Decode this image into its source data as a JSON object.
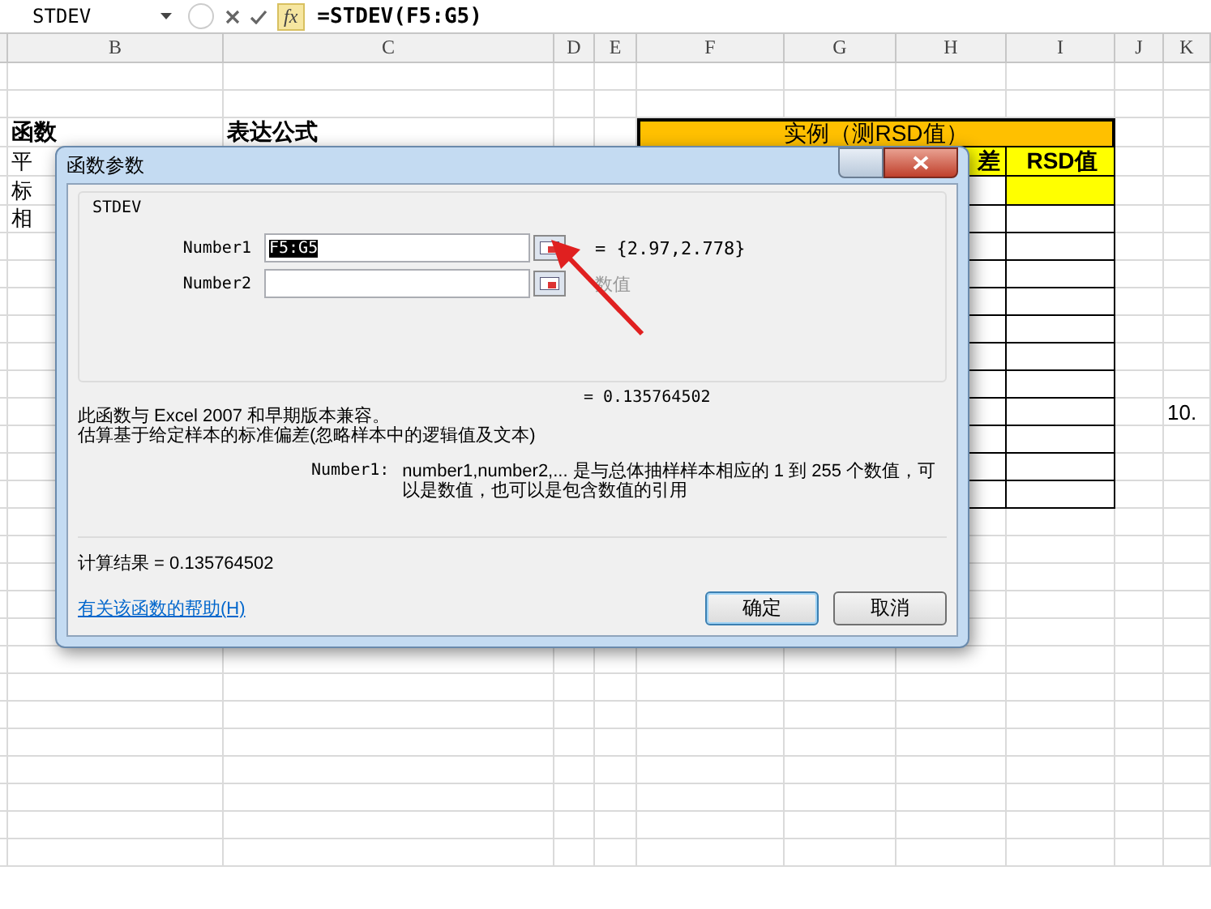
{
  "formula_bar": {
    "name_box": "STDEV",
    "fx": "fx",
    "formula": "=STDEV(F5:G5)"
  },
  "sheet": {
    "columns": [
      "B",
      "C",
      "D",
      "E",
      "F",
      "G",
      "H",
      "I",
      "J",
      "K"
    ],
    "left_table": {
      "headers": [
        "函数",
        "表达公式"
      ],
      "rows": [
        "平",
        "标",
        "相"
      ]
    },
    "rsd_table": {
      "title": "实例（测RSD值）",
      "color": "#ffc000",
      "headers": [
        "差",
        "RSD值"
      ]
    },
    "stray_value": "10."
  },
  "dialog": {
    "title": "函数参数",
    "function": "STDEV",
    "arguments": [
      {
        "label": "Number1",
        "value": "F5:G5",
        "result": "= {2.97,2.778}",
        "result_dim": false
      },
      {
        "label": "Number2",
        "result": "数值",
        "result_dim": true
      }
    ],
    "formula_result": "= 0.135764502",
    "description": [
      "此函数与 Excel 2007 和早期版本兼容。",
      "估算基于给定样本的标准偏差(忽略样本中的逻辑值及文本)"
    ],
    "arg_help_label": "Number1:",
    "arg_help": "number1,number2,... 是与总体抽样样本相应的 1 到 255 个数值，可以是数值，也可以是包含数值的引用",
    "calc_result": "计算结果 = 0.135764502",
    "help_link": "有关该函数的帮助(H)",
    "buttons": [
      {
        "label": "确定",
        "default": true
      },
      {
        "label": "取消",
        "default": false
      }
    ]
  }
}
